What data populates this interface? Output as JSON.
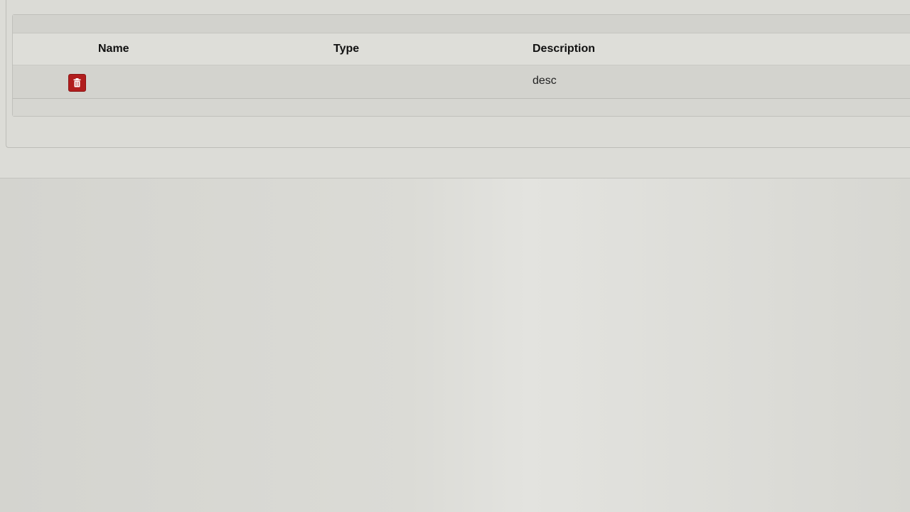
{
  "table": {
    "columns": {
      "name": "Name",
      "type": "Type",
      "description": "Description"
    },
    "rows": [
      {
        "name": "",
        "type": "",
        "description": "desc",
        "delete_icon": "trash-icon"
      }
    ]
  },
  "colors": {
    "delete_button": "#b11d1d",
    "background": "#d9d9d5"
  }
}
